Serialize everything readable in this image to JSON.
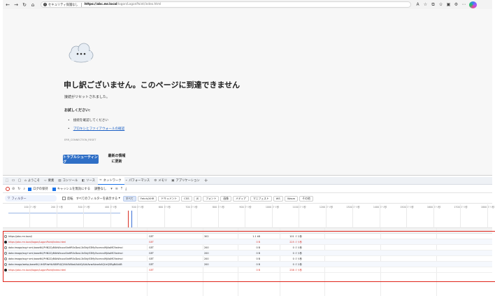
{
  "browser": {
    "security_label": "セキュリティ保護なし",
    "url_host": "https://abc.mr.local",
    "url_path": "/logon/LogonPoint/index.html",
    "icons": [
      "back-icon",
      "forward-icon",
      "refresh-icon",
      "home-icon"
    ]
  },
  "error_page": {
    "title": "申し訳ございません。このページに到達できません",
    "description": "接続がリセットされました。",
    "try_heading": "お試しください:",
    "suggestions": [
      "接続を確認してください",
      "プロキシとファイアウォールの確認"
    ],
    "error_code": "ERR_CONNECTION_RESET",
    "troubleshoot_button": "トラブルシューティング",
    "refresh_button_line1": "最新の情報",
    "refresh_button_line2": "に更新"
  },
  "devtools": {
    "tabs": [
      {
        "label": "ようこそ",
        "icon": "welcome-icon"
      },
      {
        "label": "要素",
        "icon": "elements-icon"
      },
      {
        "label": "コンソール",
        "icon": "console-icon"
      },
      {
        "label": "ソース",
        "icon": "sources-icon"
      },
      {
        "label": "ネットワーク",
        "icon": "network-icon"
      },
      {
        "label": "パフォーマンス",
        "icon": "performance-icon"
      },
      {
        "label": "メモリ",
        "icon": "memory-icon"
      },
      {
        "label": "アプリケーション",
        "icon": "application-icon"
      }
    ],
    "active_tab": "ネットワーク",
    "toolbar": {
      "preserve_log": "ログの保持",
      "disable_cache": "キャッシュを無効にする",
      "throttling": "調整なし"
    },
    "filter": {
      "placeholder": "フィルター",
      "invert": "反転",
      "hide_filter": "すべてのフィルターを表示する",
      "types": [
        "すべて",
        "Fetch/XHR",
        "ドキュメント",
        "CSS",
        "JS",
        "フォント",
        "画像",
        "メディア",
        "マニフェスト",
        "WS",
        "Wasm",
        "その他"
      ]
    },
    "timeline_ticks": [
      "100 ミリ秒",
      "200 ミリ秒",
      "300 ミリ秒",
      "400 ミリ秒",
      "500 ミリ秒",
      "600 ミリ秒",
      "700 ミリ秒",
      "800 ミリ秒",
      "900 ミリ秒",
      "1000 ミリ秒",
      "1100 ミリ秒",
      "1200 ミリ秒",
      "1300 ミリ秒",
      "1400 ミリ秒",
      "1500 ミリ秒",
      "1600 ミリ秒",
      "1700 ミリ秒",
      "1800 ミリ秒"
    ],
    "requests": [
      {
        "name": "https://abc.mr.local/",
        "method": "GET",
        "status": "302",
        "size": "1.1 kB",
        "time": "101 ミリ秒",
        "error": false
      },
      {
        "name": "https://abc.mr.local/logon/LogonPoint/index.html",
        "method": "GET",
        "status": "",
        "size": "0 B",
        "time": "225 ミリ秒",
        "error": true
      },
      {
        "name": "data:image/svg+xml;base64,PHN2ZyB4bWxucz0iaHR0cDovL3d3dy53My5vcmcvMjAwMC9zdmci",
        "method": "GET",
        "status": "200",
        "size": "0 B",
        "time": "0 ミリ秒",
        "error": false
      },
      {
        "name": "data:image/svg+xml;base64,PHN2ZyB4bWxucz0iaHR0cDovL3d3dy53My5vcmcvMjAwMC9zdmci",
        "method": "GET",
        "status": "200",
        "size": "0 B",
        "time": "0 ミリ秒",
        "error": false
      },
      {
        "name": "data:image/svg+xml;base64,PHN2ZyB4bWxucz0iaHR0cDovL3d3dy53My5vcmcvMjAwMC9zdmci",
        "method": "GET",
        "status": "200",
        "size": "0 B",
        "time": "0 ミリ秒",
        "error": false
      },
      {
        "name": "data:image/webp;base64,UklGRlwHAABXRUJQVlA4WAoAAAAQAAAAvwAAvwAAQUxQSBgBAAAB",
        "method": "GET",
        "status": "200",
        "size": "0 B",
        "time": "0 ミリ秒",
        "error": false
      },
      {
        "name": "https://abc.mr.local/logon/LogonPoint/index.html",
        "method": "GET",
        "status": "",
        "size": "0 B",
        "time": "238 ミリ秒",
        "error": true
      }
    ]
  },
  "colors": {
    "accent": "#2f6fc6",
    "error": "#d93025",
    "highlight": "#e1251b"
  }
}
